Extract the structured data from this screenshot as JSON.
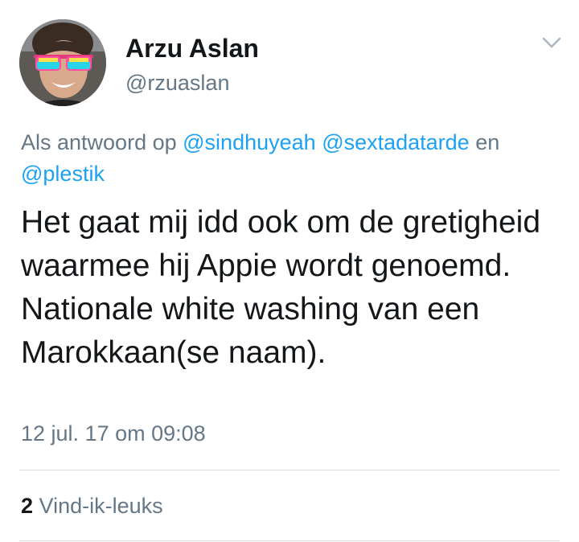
{
  "user": {
    "display_name": "Arzu Aslan",
    "handle": "@rzuaslan",
    "avatar_icon": "user-avatar-with-sunglasses"
  },
  "reply_context": {
    "prefix": "Als antwoord op",
    "mentions": [
      "@sindhuyeah",
      "@sextadatarde"
    ],
    "joiner": "en",
    "last_mention": "@plestik"
  },
  "tweet": {
    "text": "Het gaat mij idd ook om de gretigheid waarmee hij Appie wordt genoemd. Nationale white washing van een Marokkaan(se naam).",
    "timestamp": "12 jul. 17 om 09:08"
  },
  "stats": {
    "likes_count": "2",
    "likes_label": "Vind-ik-leuks"
  },
  "colors": {
    "text": "#14171a",
    "secondary": "#657786",
    "link": "#1da1f2",
    "divider": "#d7dde2"
  },
  "icons": {
    "menu": "chevron-down-icon"
  }
}
